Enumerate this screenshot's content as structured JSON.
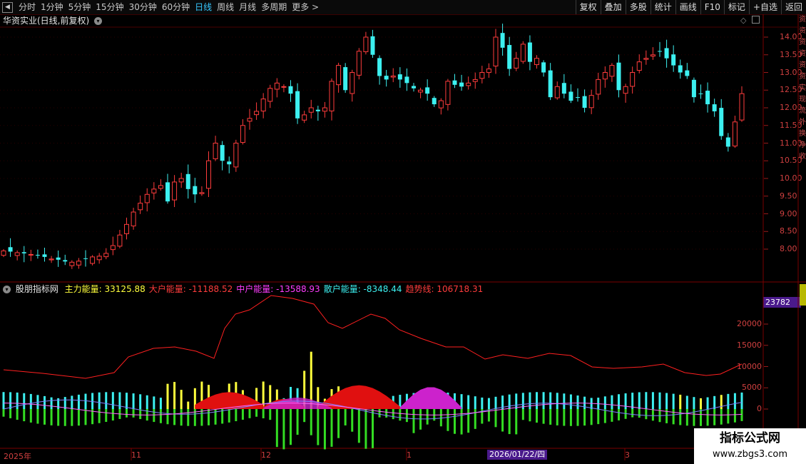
{
  "toolbar": {
    "periods": [
      "分时",
      "1分钟",
      "5分钟",
      "15分钟",
      "30分钟",
      "60分钟",
      "日线",
      "周线",
      "月线",
      "多周期",
      "更多 >"
    ],
    "active_period": "日线",
    "right_buttons": [
      "复权",
      "叠加",
      "多股",
      "统计",
      "画线",
      "F10",
      "标记",
      "+自选",
      "返回"
    ]
  },
  "stock": {
    "title": "华资实业(日线,前复权)"
  },
  "indicator": {
    "name": "股朋指标网",
    "items": [
      {
        "label": "主力能量:",
        "value": "33125.88",
        "color": "#ffff3c"
      },
      {
        "label": "大户能量:",
        "value": "-11188.52",
        "color": "#ff3c3c"
      },
      {
        "label": "中户能量:",
        "value": "-13588.93",
        "color": "#ff3cff"
      },
      {
        "label": "散户能量:",
        "value": "-8348.44",
        "color": "#3cf0f0"
      },
      {
        "label": "趋势线:",
        "value": "106718.31",
        "color": "#ff3c3c"
      }
    ],
    "badge_value": "23782"
  },
  "price_axis": [
    "14.00",
    "13.50",
    "13.00",
    "12.50",
    "12.00",
    "11.50",
    "11.00",
    "10.50",
    "10.00",
    "9.50",
    "9.00",
    "8.50",
    "8.00"
  ],
  "volume_axis": [
    "20000",
    "15000",
    "10000",
    "5000",
    "0"
  ],
  "date_axis": {
    "labels": [
      {
        "text": "2025年",
        "key": "y2025"
      },
      {
        "text": "11",
        "key": "m11"
      },
      {
        "text": "12",
        "key": "m12"
      },
      {
        "text": "1",
        "key": "m1"
      },
      {
        "text": "3",
        "key": "m3"
      }
    ],
    "cursor_date": "2026/01/22/四"
  },
  "right_strip_text": "资资资资资资实现流外换净收",
  "watermark": {
    "main": "指标公式网",
    "sub": "www.zbgs3.com"
  },
  "colors": {
    "up": "#ff3c3c",
    "down": "#3cf0f0",
    "trend": "#ff2020"
  },
  "chart_data": {
    "type": "candlestick",
    "price_ylim": [
      7.5,
      14.3
    ],
    "close": [
      7.95,
      7.93,
      7.9,
      7.88,
      7.85,
      7.82,
      7.78,
      7.72,
      7.7,
      7.65,
      7.63,
      7.66,
      7.72,
      7.78,
      7.8,
      7.88,
      8.1,
      8.4,
      8.7,
      9.05,
      9.3,
      9.55,
      9.7,
      9.8,
      9.35,
      9.9,
      10.0,
      9.7,
      9.55,
      9.6,
      10.5,
      11.0,
      10.5,
      10.4,
      11.0,
      11.5,
      11.7,
      11.9,
      12.25,
      12.55,
      12.7,
      12.6,
      12.4,
      11.7,
      11.8,
      12.0,
      11.9,
      12.0,
      12.75,
      13.2,
      12.5,
      13.0,
      13.6,
      14.0,
      13.5,
      12.9,
      12.8,
      12.9,
      12.8,
      12.7,
      12.55,
      12.5,
      12.4,
      12.1,
      12.2,
      12.75,
      12.65,
      12.6,
      12.7,
      12.8,
      13.0,
      13.1,
      14.0,
      13.7,
      13.1,
      13.4,
      13.8,
      13.3,
      13.4,
      13.0,
      12.3,
      12.6,
      12.4,
      12.2,
      12.3,
      12.0,
      12.35,
      12.8,
      13.0,
      13.2,
      12.5,
      12.6,
      13.0,
      13.3,
      13.4,
      13.5,
      13.6,
      13.4,
      13.2,
      13.0,
      12.9,
      12.3,
      12.4,
      12.1,
      11.9,
      11.2,
      10.9,
      11.6,
      12.4
    ]
  }
}
